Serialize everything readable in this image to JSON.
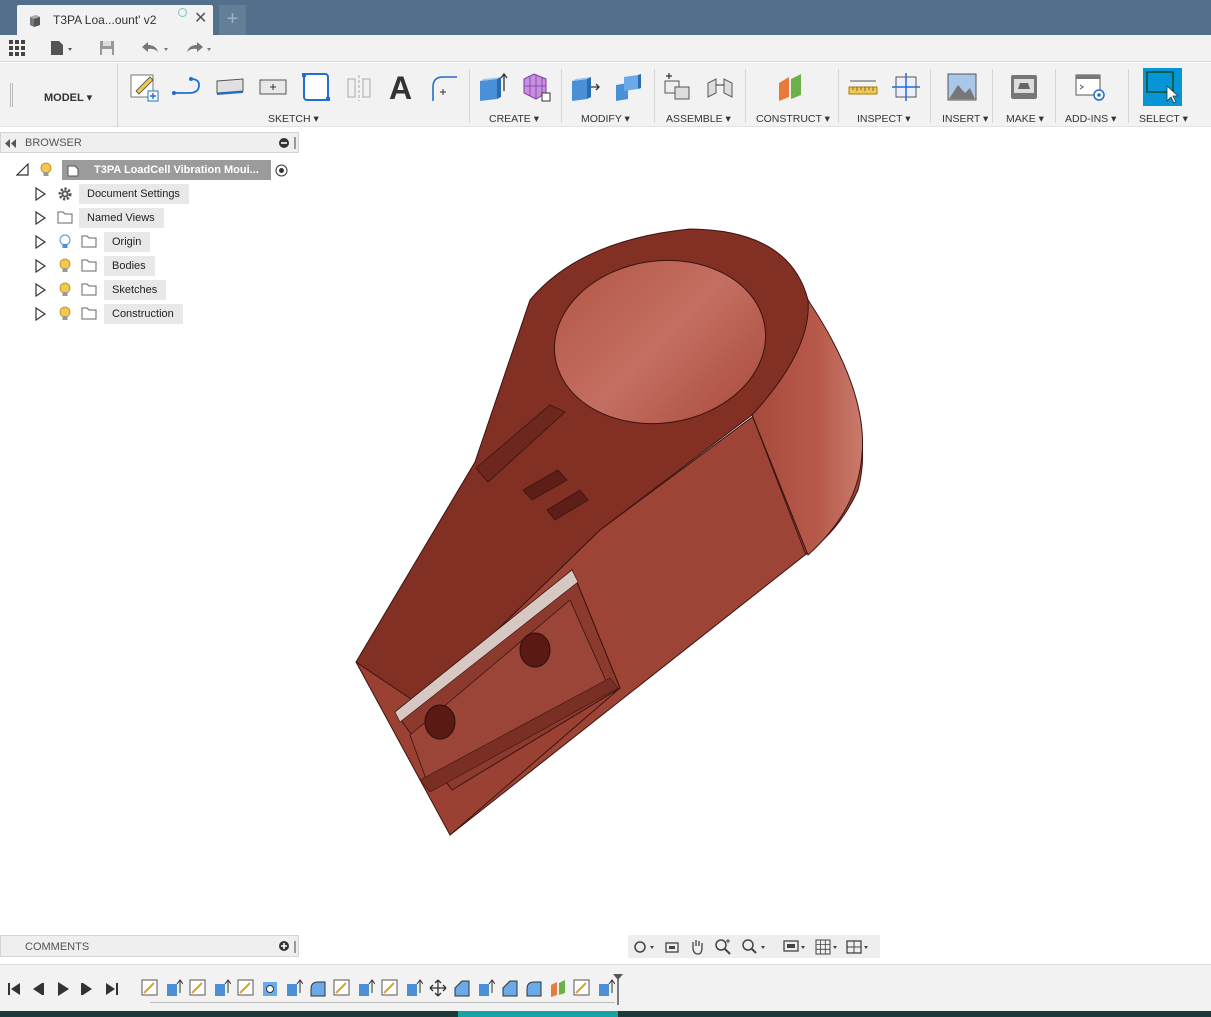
{
  "document": {
    "tab_title": "T3PA Loa...ount' v2",
    "new_tab": "+"
  },
  "toolbar": {
    "workspace": "MODEL",
    "groups": [
      {
        "label": "SKETCH ▾"
      },
      {
        "label": "CREATE ▾"
      },
      {
        "label": "MODIFY ▾"
      },
      {
        "label": "ASSEMBLE ▾"
      },
      {
        "label": "CONSTRUCT ▾"
      },
      {
        "label": "INSPECT ▾"
      },
      {
        "label": "INSERT ▾"
      },
      {
        "label": "MAKE ▾"
      },
      {
        "label": "ADD-INS ▾"
      },
      {
        "label": "SELECT ▾"
      }
    ],
    "sketch_text_icon": "A"
  },
  "browser": {
    "title": "BROWSER",
    "root": "T3PA LoadCell Vibration Moui...",
    "items": [
      {
        "label": "Document Settings",
        "icon": "gear-icon"
      },
      {
        "label": "Named Views",
        "icon": "folder-icon"
      },
      {
        "label": "Origin",
        "icon": "folder-icon"
      },
      {
        "label": "Bodies",
        "icon": "folder-icon"
      },
      {
        "label": "Sketches",
        "icon": "folder-icon"
      },
      {
        "label": "Construction",
        "icon": "folder-icon"
      }
    ]
  },
  "comments": {
    "title": "COMMENTS"
  },
  "colors": {
    "accent": "#0696d7",
    "title_bar": "#52708b",
    "model_body": "#8b3a2e",
    "bulb": "#f2c94c"
  }
}
